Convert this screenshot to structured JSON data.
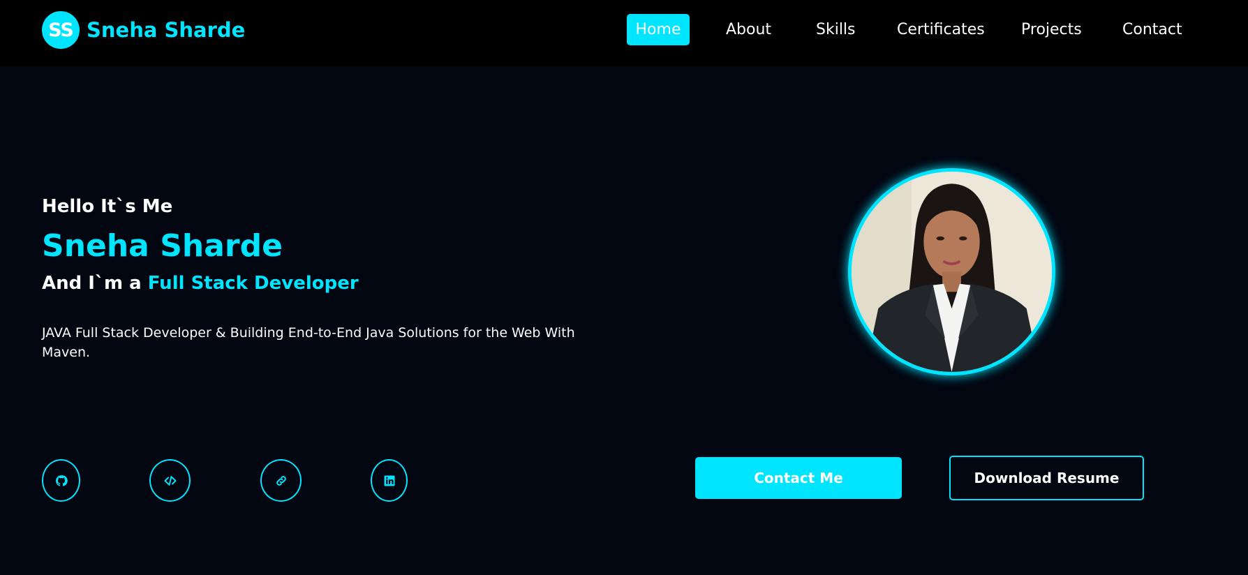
{
  "brand": {
    "initials": "SS",
    "name": "Sneha Sharde"
  },
  "nav": {
    "items": [
      {
        "label": "Home",
        "active": true
      },
      {
        "label": "About"
      },
      {
        "label": "Skills"
      },
      {
        "label": "Certificates"
      },
      {
        "label": "Projects"
      },
      {
        "label": "Contact"
      }
    ]
  },
  "hero": {
    "greeting": "Hello It`s Me",
    "name": "Sneha Sharde",
    "role_prefix": "And I`m a ",
    "role_highlight": "Full Stack Developer",
    "description": "JAVA Full Stack Developer & Building End-to-End Java Solutions for the Web With Maven."
  },
  "social_links": [
    {
      "icon": "github-icon"
    },
    {
      "icon": "code-icon"
    },
    {
      "icon": "link-icon"
    },
    {
      "icon": "linkedin-icon"
    }
  ],
  "buttons": {
    "contact": "Contact Me",
    "resume": "Download Resume"
  },
  "theme": {
    "accent": "#00e5ff",
    "background": "#020611",
    "navbar": "#000000",
    "text": "#ffffff"
  }
}
